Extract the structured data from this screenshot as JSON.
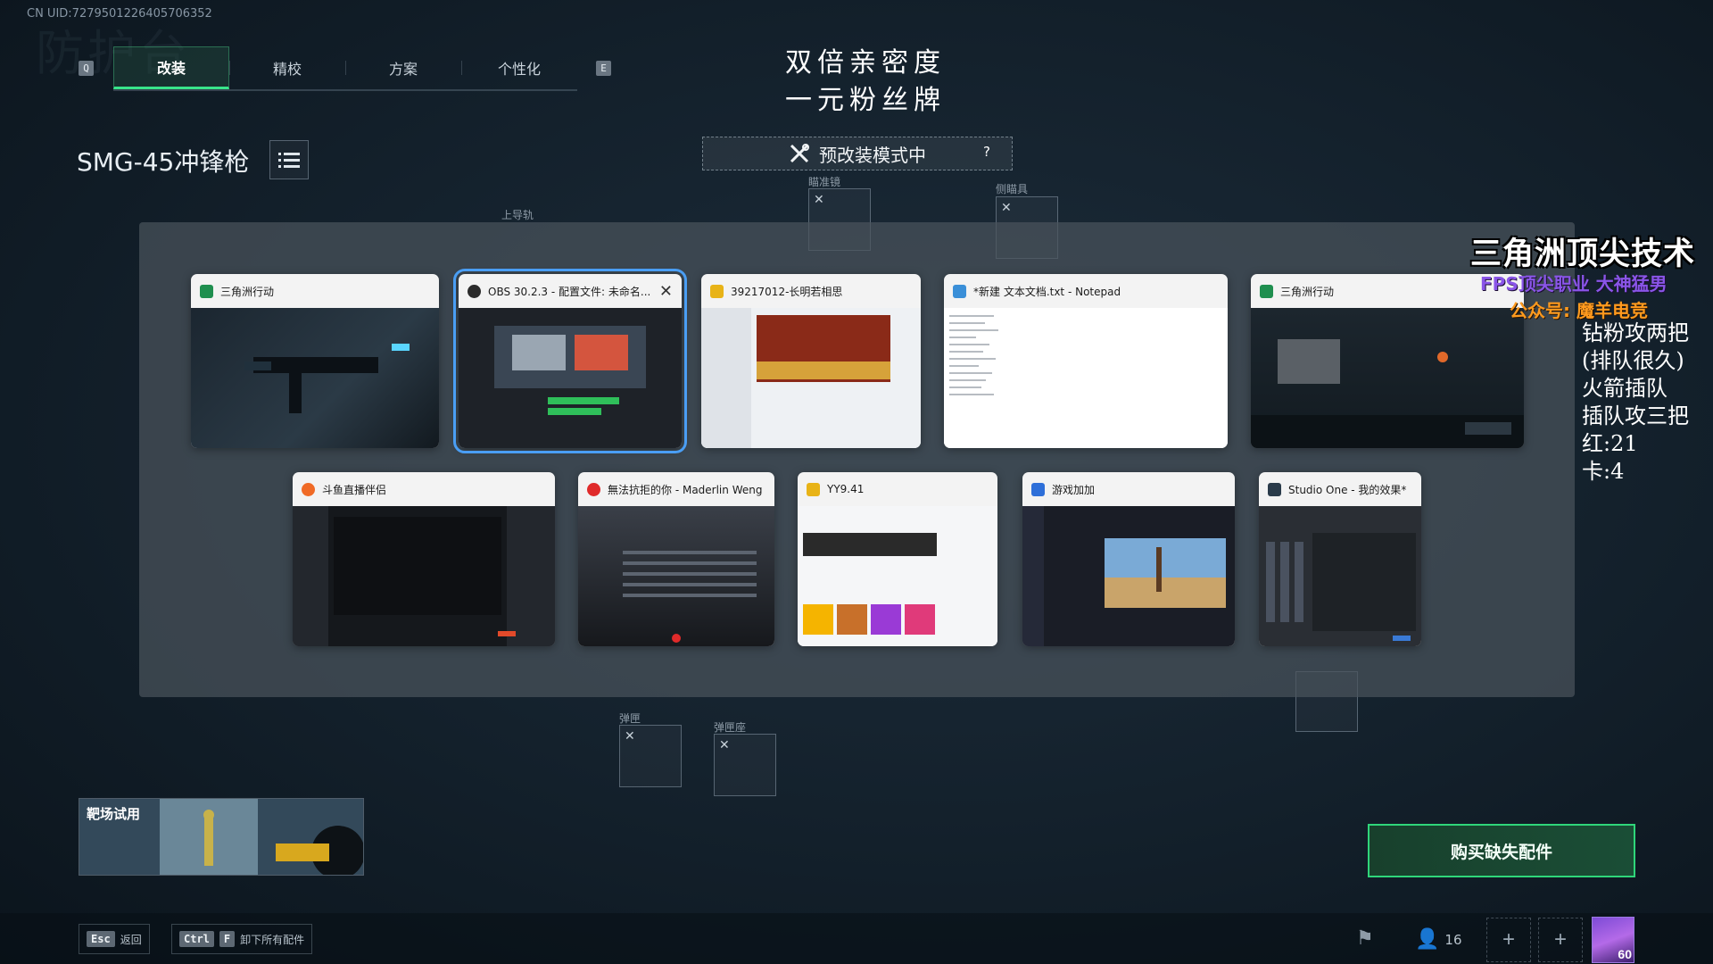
{
  "uid": "CN UID:7279501226405706352",
  "bg_word": "防护台",
  "tabs": {
    "left_key": "Q",
    "right_key": "E",
    "items": [
      {
        "label": "改装",
        "active": true
      },
      {
        "label": "精校",
        "active": false
      },
      {
        "label": "方案",
        "active": false
      },
      {
        "label": "个性化",
        "active": false
      }
    ]
  },
  "promo": {
    "line1": "双倍亲密度",
    "line2": "一元粉丝牌"
  },
  "weapon_name": "SMG-45冲锋枪",
  "mode_banner": {
    "label": "预改装模式中",
    "help": "?"
  },
  "slots": {
    "scope": "瞄准镜",
    "side": "侧瞄具",
    "top_rail": "上导轨",
    "mag": "弹匣",
    "mag_base": "弹匣座"
  },
  "switcher": {
    "row1": [
      {
        "title": "三角洲行动",
        "icon_color": "#1f8f4f"
      },
      {
        "title": "OBS 30.2.3 - 配置文件: 未命名...",
        "icon_color": "#2b2b2b",
        "selected": true
      },
      {
        "title": "39217012-长明若相思",
        "icon_color": "#e8b317"
      },
      {
        "title": "*新建 文本文档.txt - Notepad",
        "icon_color": "#3a8fd8"
      },
      {
        "title": "三角洲行动",
        "icon_color": "#1f8f4f"
      }
    ],
    "row2": [
      {
        "title": "斗鱼直播伴侣",
        "icon_color": "#f06a26"
      },
      {
        "title": "無法抗拒的你 - Maderlin Weng",
        "icon_color": "#e02a2a"
      },
      {
        "title": "YY9.41",
        "icon_color": "#e8b317"
      },
      {
        "title": "游戏加加",
        "icon_color": "#2e6fd9"
      },
      {
        "title": "Studio One - 我的效果*",
        "icon_color": "#2a3b4a"
      }
    ]
  },
  "overlay": {
    "title": "三角洲顶尖技术",
    "subtitle": "FPS顶尖职业  大神猛男",
    "wechat": "公众号: 魔羊电竞",
    "notes": "钻粉攻两把\n(排队很久)\n火箭插队\n插队攻三把\n红:21\n卡:4"
  },
  "range_preview": {
    "label": "靶场试用"
  },
  "buy_button": "购买缺失配件",
  "footer": {
    "esc_key": "Esc",
    "esc_label": "返回",
    "ctrl_key": "Ctrl",
    "f_key": "F",
    "unload_label": "卸下所有配件",
    "squad_count": "16",
    "level": "60"
  },
  "colors": {
    "accent_green": "#38e58a",
    "selection_blue": "#4a9ef4",
    "panel_gray": "#4a535c"
  }
}
